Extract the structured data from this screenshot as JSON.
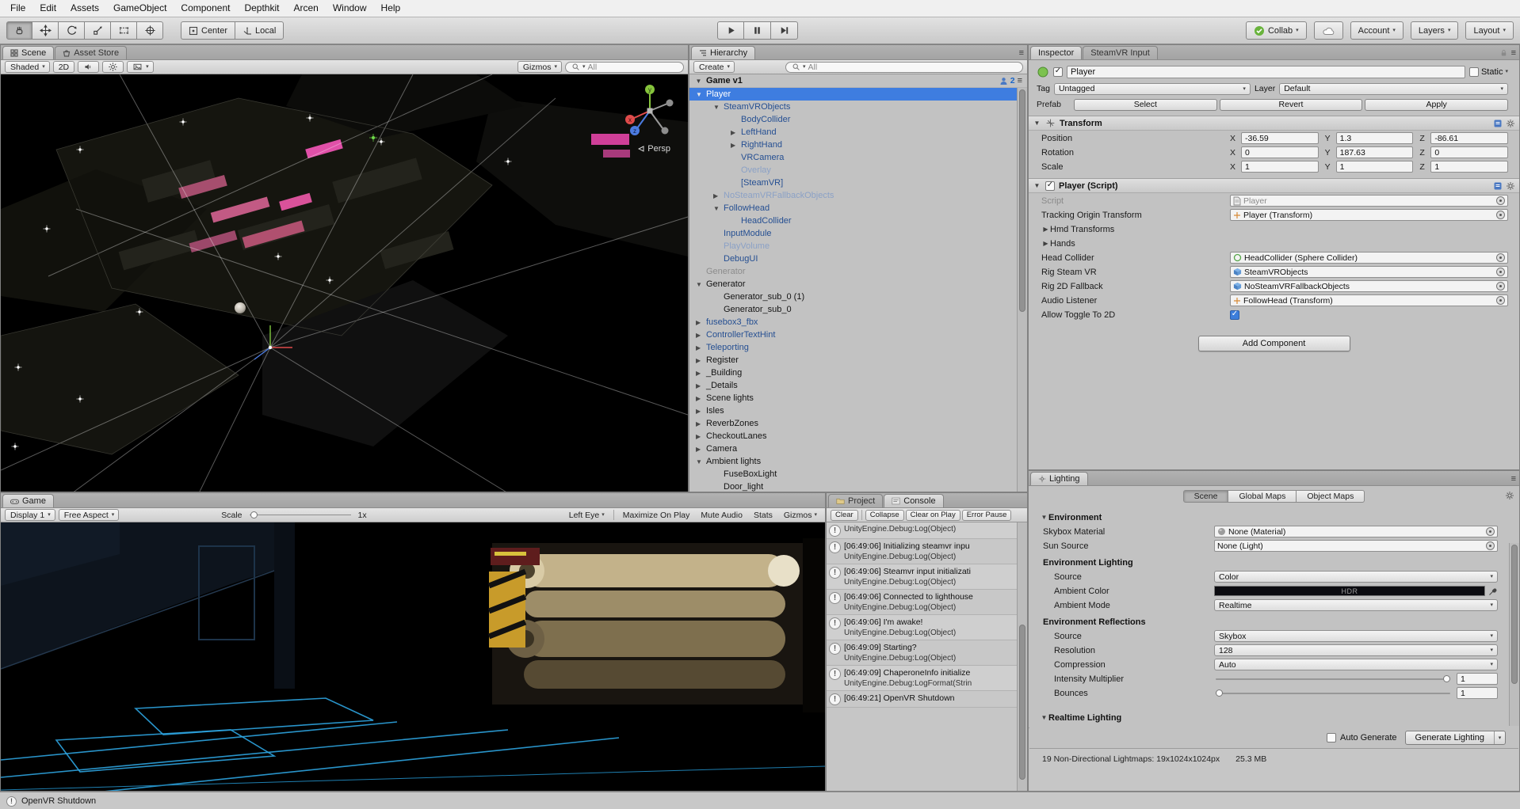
{
  "icons": {
    "caret": "▾",
    "fold_open": "▼",
    "fold_closed": "▶",
    "check": "✓",
    "log_bang": "!",
    "menu_glyph": "≡",
    "tool_icons": [
      "hand-tool-icon",
      "move-tool-icon",
      "rotate-tool-icon",
      "scale-tool-icon",
      "rect-tool-icon",
      "transform-tool-icon"
    ]
  },
  "menu_bar": {
    "items": [
      {
        "label": "File"
      },
      {
        "label": "Edit"
      },
      {
        "label": "Assets"
      },
      {
        "label": "GameObject"
      },
      {
        "label": "Component"
      },
      {
        "label": "Depthkit"
      },
      {
        "label": "Arcen"
      },
      {
        "label": "Window"
      },
      {
        "label": "Help"
      }
    ]
  },
  "toolbar": {
    "pivot_label": "Center",
    "space_label": "Local",
    "collab_label": "Collab",
    "account_label": "Account",
    "layers_label": "Layers",
    "layout_label": "Layout",
    "collab_green": "#69b33c"
  },
  "scene_view": {
    "tabs": [
      {
        "label": "Scene"
      },
      {
        "label": "Asset Store"
      }
    ],
    "shading_mode": "Shaded",
    "toggle_2d": "2D",
    "gizmos_label": "Gizmos",
    "search_value": "All",
    "persp_label": "Persp",
    "axes": {
      "x": "x",
      "y": "y",
      "z": "z"
    }
  },
  "hierarchy": {
    "tab_label": "Hierarchy",
    "create_label": "Create",
    "search_value": "All",
    "scene_row": {
      "name": "Game v1",
      "collab_count": "2"
    },
    "items": [
      {
        "label": "Player",
        "depth": 0,
        "arrow": "open",
        "state": "selected"
      },
      {
        "label": "SteamVRObjects",
        "depth": 1,
        "arrow": "open",
        "state": "prefab"
      },
      {
        "label": "BodyCollider",
        "depth": 2,
        "arrow": "none",
        "state": "prefab"
      },
      {
        "label": "LeftHand",
        "depth": 2,
        "arrow": "closed",
        "state": "prefab"
      },
      {
        "label": "RightHand",
        "depth": 2,
        "arrow": "closed",
        "state": "prefab"
      },
      {
        "label": "VRCamera",
        "depth": 2,
        "arrow": "none",
        "state": "prefab"
      },
      {
        "label": "Overlay",
        "depth": 2,
        "arrow": "none",
        "state": "prefab-dim"
      },
      {
        "label": "[SteamVR]",
        "depth": 2,
        "arrow": "none",
        "state": "prefab"
      },
      {
        "label": "NoSteamVRFallbackObjects",
        "depth": 1,
        "arrow": "closed",
        "state": "prefab-dim"
      },
      {
        "label": "FollowHead",
        "depth": 1,
        "arrow": "open",
        "state": "prefab"
      },
      {
        "label": "HeadCollider",
        "depth": 2,
        "arrow": "none",
        "state": "prefab"
      },
      {
        "label": "InputModule",
        "depth": 1,
        "arrow": "none",
        "state": "prefab"
      },
      {
        "label": "PlayVolume",
        "depth": 1,
        "arrow": "none",
        "state": "prefab-dim"
      },
      {
        "label": "DebugUI",
        "depth": 1,
        "arrow": "none",
        "state": "prefab"
      },
      {
        "label": "Generator",
        "depth": 0,
        "arrow": "none",
        "state": "dim"
      },
      {
        "label": "Generator",
        "depth": 0,
        "arrow": "open",
        "state": ""
      },
      {
        "label": "Generator_sub_0 (1)",
        "depth": 1,
        "arrow": "none",
        "state": ""
      },
      {
        "label": "Generator_sub_0",
        "depth": 1,
        "arrow": "none",
        "state": ""
      },
      {
        "label": "fusebox3_fbx",
        "depth": 0,
        "arrow": "closed",
        "state": "prefab"
      },
      {
        "label": "ControllerTextHint",
        "depth": 0,
        "arrow": "closed",
        "state": "prefab"
      },
      {
        "label": "Teleporting",
        "depth": 0,
        "arrow": "closed",
        "state": "prefab"
      },
      {
        "label": "Register",
        "depth": 0,
        "arrow": "closed",
        "state": ""
      },
      {
        "label": "_Building",
        "depth": 0,
        "arrow": "closed",
        "state": ""
      },
      {
        "label": "_Details",
        "depth": 0,
        "arrow": "closed",
        "state": ""
      },
      {
        "label": "Scene lights",
        "depth": 0,
        "arrow": "closed",
        "state": ""
      },
      {
        "label": "Isles",
        "depth": 0,
        "arrow": "closed",
        "state": ""
      },
      {
        "label": "ReverbZones",
        "depth": 0,
        "arrow": "closed",
        "state": ""
      },
      {
        "label": "CheckoutLanes",
        "depth": 0,
        "arrow": "closed",
        "state": ""
      },
      {
        "label": "Camera",
        "depth": 0,
        "arrow": "closed",
        "state": ""
      },
      {
        "label": "Ambient lights",
        "depth": 0,
        "arrow": "open",
        "state": ""
      },
      {
        "label": "FuseBoxLight",
        "depth": 1,
        "arrow": "none",
        "state": ""
      },
      {
        "label": "Door_light",
        "depth": 1,
        "arrow": "none",
        "state": ""
      }
    ]
  },
  "inspector": {
    "tabs": [
      {
        "label": "Inspector"
      },
      {
        "label": "SteamVR Input"
      }
    ],
    "header": {
      "name": "Player",
      "static_label": "Static"
    },
    "tag_row": {
      "tag_label": "Tag",
      "tag_value": "Untagged",
      "layer_label": "Layer",
      "layer_value": "Default"
    },
    "prefab_row": {
      "label": "Prefab",
      "select": "Select",
      "revert": "Revert",
      "apply": "Apply"
    },
    "transform": {
      "title": "Transform",
      "axis_labels": [
        "X",
        "Y",
        "Z"
      ],
      "rows": [
        {
          "label": "Position",
          "x": "-36.59",
          "y": "1.3",
          "z": "-86.61"
        },
        {
          "label": "Rotation",
          "x": "0",
          "y": "187.63",
          "z": "0"
        },
        {
          "label": "Scale",
          "x": "1",
          "y": "1",
          "z": "1"
        }
      ]
    },
    "player_script": {
      "title": "Player (Script)",
      "fields": [
        {
          "label": "Script",
          "value": "Player"
        },
        {
          "label": "Tracking Origin Transform",
          "value": "Player (Transform)"
        },
        {
          "label": "Hmd Transforms"
        },
        {
          "label": "Hands"
        },
        {
          "label": "Head Collider",
          "value": "HeadCollider (Sphere Collider)"
        },
        {
          "label": "Rig Steam VR",
          "value": "SteamVRObjects"
        },
        {
          "label": "Rig 2D Fallback",
          "value": "NoSteamVRFallbackObjects"
        },
        {
          "label": "Audio Listener",
          "value": "FollowHead (Transform)"
        },
        {
          "label": "Allow Toggle To 2D",
          "checked": true
        }
      ]
    },
    "add_component_label": "Add Component"
  },
  "lighting": {
    "tab_label": "Lighting",
    "tabs": [
      {
        "label": "Scene"
      },
      {
        "label": "Global Maps"
      },
      {
        "label": "Object Maps"
      }
    ],
    "environment_title": "Environment",
    "rows": {
      "skybox": {
        "label": "Skybox Material",
        "value": "None (Material)"
      },
      "sun": {
        "label": "Sun Source",
        "value": "None (Light)"
      },
      "env_lighting_title": "Environment Lighting",
      "source": {
        "label": "Source",
        "value": "Color"
      },
      "ambient_color": {
        "label": "Ambient Color",
        "hdr_label": "HDR"
      },
      "ambient_mode": {
        "label": "Ambient Mode",
        "value": "Realtime"
      },
      "env_reflections_title": "Environment Reflections",
      "refl_source": {
        "label": "Source",
        "value": "Skybox"
      },
      "resolution": {
        "label": "Resolution",
        "value": "128"
      },
      "compression": {
        "label": "Compression",
        "value": "Auto"
      },
      "intensity": {
        "label": "Intensity Multiplier",
        "value": "1"
      },
      "bounces": {
        "label": "Bounces",
        "value": "1"
      }
    },
    "realtime_title": "Realtime Lighting",
    "auto_generate_label": "Auto Generate",
    "generate_label": "Generate Lighting",
    "stats_line": "19 Non-Directional Lightmaps: 19x1024x1024px",
    "stats_size": "25.3 MB"
  },
  "game_view": {
    "tab_label": "Game",
    "display": "Display 1",
    "aspect": "Free Aspect",
    "scale_label": "Scale",
    "scale_value": "1x",
    "eye_mode": "Left Eye",
    "maximize_label": "Maximize On Play",
    "mute_label": "Mute Audio",
    "stats_label": "Stats",
    "gizmos_label": "Gizmos"
  },
  "console": {
    "tabs": [
      {
        "label": "Project"
      },
      {
        "label": "Console"
      }
    ],
    "buttons": [
      {
        "label": "Clear"
      },
      {
        "label": "Collapse"
      },
      {
        "label": "Clear on Play"
      },
      {
        "label": "Error Pause"
      }
    ],
    "entries": [
      {
        "message": "",
        "trace": "UnityEngine.Debug:Log(Object)"
      },
      {
        "message": "[06:49:06] Initializing steamvr inpu",
        "trace": "UnityEngine.Debug:Log(Object)"
      },
      {
        "message": "[06:49:06] Steamvr input initializati",
        "trace": "UnityEngine.Debug:Log(Object)"
      },
      {
        "message": "[06:49:06] Connected to lighthouse",
        "trace": "UnityEngine.Debug:Log(Object)"
      },
      {
        "message": "[06:49:06] I'm awake!",
        "trace": "UnityEngine.Debug:Log(Object)"
      },
      {
        "message": "[06:49:09] Starting?",
        "trace": "UnityEngine.Debug:Log(Object)"
      },
      {
        "message": "[06:49:09] ChaperoneInfo initialize",
        "trace": "UnityEngine.Debug:LogFormat(Strin"
      },
      {
        "message": "[06:49:21] OpenVR Shutdown",
        "trace": ""
      }
    ]
  },
  "status_bar": {
    "message": "OpenVR Shutdown"
  }
}
